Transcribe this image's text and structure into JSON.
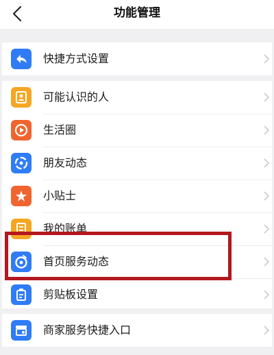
{
  "header": {
    "title": "功能管理"
  },
  "groups": [
    {
      "items": [
        {
          "label": "快捷方式设置",
          "icon": "reply-arrow-icon",
          "color": "#2f7cf6"
        }
      ]
    },
    {
      "items": [
        {
          "label": "可能认识的人",
          "icon": "contact-card-icon",
          "color": "#f5a623"
        },
        {
          "label": "生活圈",
          "icon": "play-circle-icon",
          "color": "#f0652f"
        },
        {
          "label": "朋友动态",
          "icon": "friends-ring-icon",
          "color": "#2f7cf6"
        },
        {
          "label": "小贴士",
          "icon": "star-tip-icon",
          "color": "#f0652f"
        },
        {
          "label": "我的账单",
          "icon": "bill-icon",
          "color": "#f5a623"
        },
        {
          "label": "首页服务动态",
          "icon": "eye-service-icon",
          "color": "#2f7cf6"
        },
        {
          "label": "剪贴板设置",
          "icon": "clipboard-icon",
          "color": "#2f7cf6"
        }
      ]
    },
    {
      "items": [
        {
          "label": "商家服务快捷入口",
          "icon": "store-icon",
          "color": "#2f7cf6"
        }
      ]
    }
  ],
  "annotation": {
    "highlight_color": "#b3171f"
  }
}
